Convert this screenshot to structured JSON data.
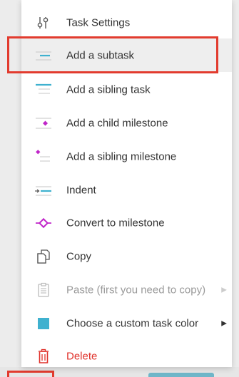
{
  "menu": {
    "items": [
      {
        "label": "Task Settings",
        "icon": "sliders-icon"
      },
      {
        "label": "Add a subtask",
        "icon": "subtask-icon"
      },
      {
        "label": "Add a sibling task",
        "icon": "sibling-task-icon"
      },
      {
        "label": "Add a child milestone",
        "icon": "child-milestone-icon"
      },
      {
        "label": "Add a sibling milestone",
        "icon": "sibling-milestone-icon"
      },
      {
        "label": "Indent",
        "icon": "indent-icon"
      },
      {
        "label": "Convert to milestone",
        "icon": "diamond-icon"
      },
      {
        "label": "Copy",
        "icon": "copy-icon"
      },
      {
        "label": "Paste (first you need to copy)",
        "icon": "paste-icon"
      },
      {
        "label": "Choose a custom task color",
        "icon": "color-swatch-icon"
      },
      {
        "label": "Delete",
        "icon": "trash-icon"
      }
    ],
    "highlighted_index": 1
  },
  "colors": {
    "accent_teal": "#3fb1cf",
    "milestone_magenta": "#c026c9",
    "danger_red": "#e0322b",
    "annotation_red": "#e23b2e"
  }
}
